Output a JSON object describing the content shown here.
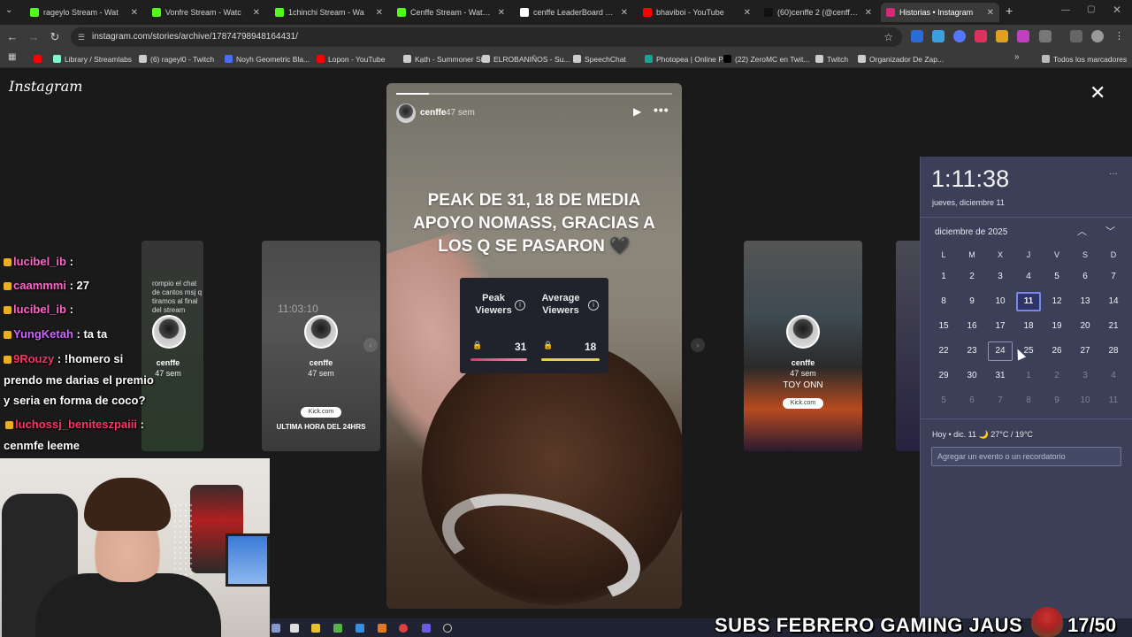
{
  "browser": {
    "tabs": [
      {
        "title": "rageylo Stream - Wat",
        "color": "#53fc18",
        "active": false
      },
      {
        "title": "Vonfre Stream - Watc",
        "color": "#53fc18",
        "active": false
      },
      {
        "title": "1chinchi Stream - Wa",
        "color": "#53fc18",
        "active": false
      },
      {
        "title": "Cenffe Stream - Watch Li",
        "color": "#53fc18",
        "active": false
      },
      {
        "title": "cenffe LeaderBoard | The",
        "color": "#ffffff",
        "active": false
      },
      {
        "title": "bhaviboi - YouTube",
        "color": "#ff0000",
        "active": false
      },
      {
        "title": "(60)cenffe 2 (@cenffe2) |",
        "color": "#111111",
        "active": false
      },
      {
        "title": "Historias • Instagram",
        "color": "#d62976",
        "active": true
      }
    ],
    "url": "instagram.com/stories/archive/17874798948164431/",
    "bookmarks": [
      {
        "label": "",
        "color": "#ff0000"
      },
      {
        "label": "Library / Streamlabs",
        "color": "#80f5d2"
      },
      {
        "label": "(6) rageyl0 - Twitch",
        "color": "#cccccc"
      },
      {
        "label": "Noyh Geometric Bla...",
        "color": "#4a6cf7"
      },
      {
        "label": "Lopon - YouTube",
        "color": "#ff0000"
      },
      {
        "label": "Kạth - Summoner St...",
        "color": "#cccccc"
      },
      {
        "label": "ELROBANIÑOS - Su...",
        "color": "#cccccc"
      },
      {
        "label": "SpeechChat",
        "color": "#cccccc"
      },
      {
        "label": "Photopea | Online P...",
        "color": "#18a497"
      },
      {
        "label": "(22) ZeroMC en Twit...",
        "color": "#000000"
      },
      {
        "label": "Twitch",
        "color": "#cccccc"
      },
      {
        "label": "Organizador De Zap...",
        "color": "#cccccc"
      }
    ],
    "all_bookmarks": "Todos los marcadores"
  },
  "instagram": {
    "logo": "Instagram",
    "story": {
      "user": "cenffe",
      "time": "47 sem",
      "caption": "PEAK DE 31, 18 DE MEDIA APOYO NOMASS, GRACIAS A LOS Q SE PASARON 🖤",
      "progress": 0.12,
      "stats": {
        "peak_label": "Peak Viewers",
        "peak_value": "31",
        "average_label": "Average Viewers",
        "average_value": "18"
      }
    },
    "thumbnails": [
      {
        "user": "cenffe",
        "time": "47 sem",
        "text": "rompio el chat de cantos msj q tiramos al final del stream"
      },
      {
        "user": "cenffe",
        "time": "47 sem",
        "text": "ULTIMA HORA DEL 24HRS",
        "date_text": "11:03:10"
      },
      {
        "user": "cenffe",
        "time": "47 sem",
        "text": "TOY ONN",
        "link": "Kick.com"
      }
    ],
    "thumb_kick_link": "Kick.com"
  },
  "chat": [
    {
      "user": "lucibel_ib",
      "msg": "",
      "color": "#ff66cc"
    },
    {
      "user": "caammmi",
      "msg": "27",
      "color": "#ff66cc"
    },
    {
      "user": "lucibel_ib",
      "msg": "",
      "color": "#ff66cc"
    },
    {
      "user": "YungKetah",
      "msg": "ta ta",
      "color": "#cc66ff"
    },
    {
      "user": "9Rouzy",
      "msg": "!homero si",
      "color": "#ff3366"
    },
    {
      "user": "",
      "msg": "prendo me darias el premio",
      "color": "#ffffff"
    },
    {
      "user": "",
      "msg": "y seria en forma de coco?",
      "color": "#ffffff"
    },
    {
      "user": "luchossj_beniteszpaiii",
      "msg": "",
      "color": "#ff3366"
    },
    {
      "user": "",
      "msg": "cenmfe leeme",
      "color": "#ffffff"
    }
  ],
  "calendar": {
    "time": "1:11:38",
    "date": "jueves, diciembre 11",
    "month": "diciembre de 2025",
    "weekdays": [
      "L",
      "M",
      "X",
      "J",
      "V",
      "S",
      "D"
    ],
    "weeks": [
      [
        {
          "d": "1"
        },
        {
          "d": "2"
        },
        {
          "d": "3"
        },
        {
          "d": "4"
        },
        {
          "d": "5"
        },
        {
          "d": "6"
        },
        {
          "d": "7"
        }
      ],
      [
        {
          "d": "8"
        },
        {
          "d": "9"
        },
        {
          "d": "10"
        },
        {
          "d": "11",
          "today": true
        },
        {
          "d": "12"
        },
        {
          "d": "13"
        },
        {
          "d": "14"
        }
      ],
      [
        {
          "d": "15"
        },
        {
          "d": "16"
        },
        {
          "d": "17"
        },
        {
          "d": "18"
        },
        {
          "d": "19"
        },
        {
          "d": "20"
        },
        {
          "d": "21"
        }
      ],
      [
        {
          "d": "22"
        },
        {
          "d": "23"
        },
        {
          "d": "24",
          "hover": true
        },
        {
          "d": "25"
        },
        {
          "d": "26"
        },
        {
          "d": "27"
        },
        {
          "d": "28"
        }
      ],
      [
        {
          "d": "29"
        },
        {
          "d": "30"
        },
        {
          "d": "31"
        },
        {
          "d": "1",
          "other": true
        },
        {
          "d": "2",
          "other": true
        },
        {
          "d": "3",
          "other": true
        },
        {
          "d": "4",
          "other": true
        }
      ],
      [
        {
          "d": "5",
          "other": true
        },
        {
          "d": "6",
          "other": true
        },
        {
          "d": "7",
          "other": true
        },
        {
          "d": "8",
          "other": true
        },
        {
          "d": "9",
          "other": true
        },
        {
          "d": "10",
          "other": true
        },
        {
          "d": "11",
          "other": true
        }
      ]
    ],
    "weather": "Hoy • dic. 11  🌙 27°C / 19°C",
    "event_placeholder": "Agregar un evento o un recordatorio"
  },
  "overlay": {
    "subs_text": "SUBS FEBRERO GAMING JAUS",
    "subs_count": "17/50"
  }
}
